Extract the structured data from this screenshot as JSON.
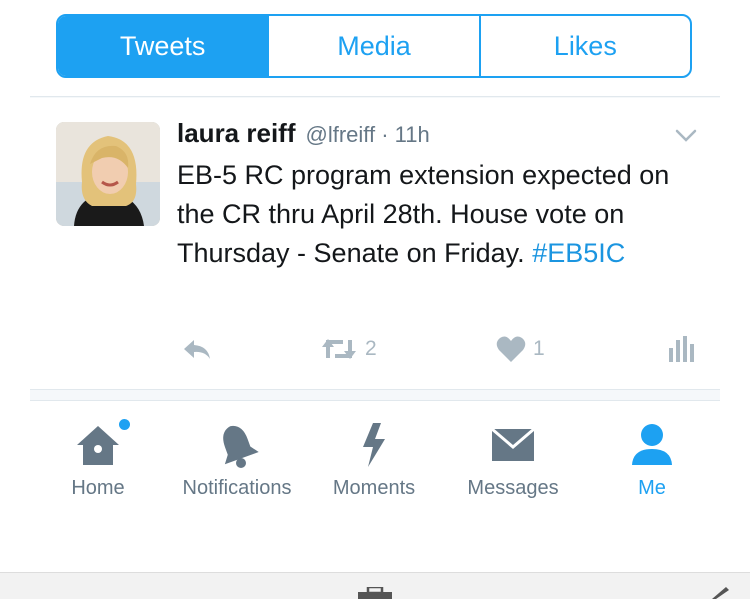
{
  "tabs": [
    "Tweets",
    "Media",
    "Likes"
  ],
  "active_tab": "Tweets",
  "tweet": {
    "name": "laura reiff",
    "handle": "@lfreiff · 11h",
    "text": "EB-5 RC program extension expected on the CR thru April 28th. House vote on Thursday - Senate on Friday.",
    "hashtag": "#EB5IC",
    "retweet_count": "2",
    "like_count": "1"
  },
  "tabbar": {
    "items": [
      "Home",
      "Notifications",
      "Moments",
      "Messages",
      "Me"
    ],
    "active": "Me"
  },
  "colors": {
    "accent": "#1da1f2",
    "hashtag": "#1b95e0",
    "icon_grey": "#657786",
    "action_grey": "#aab8c2"
  }
}
